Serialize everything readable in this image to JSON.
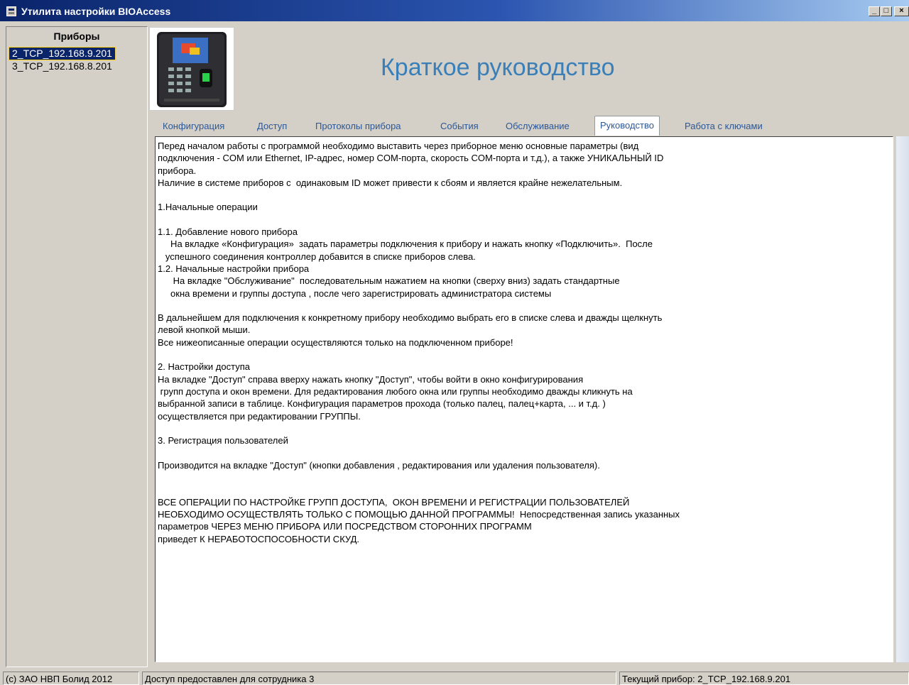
{
  "window": {
    "title": "Утилита настройки BIOAccess",
    "min": "_",
    "max": "□",
    "close": "×"
  },
  "sidebar": {
    "header": "Приборы",
    "devices": [
      {
        "label": "2_TCP_192.168.9.201",
        "selected": true
      },
      {
        "label": "3_TCP_192.168.8.201",
        "selected": false
      }
    ]
  },
  "header": {
    "title": "Краткое руководство"
  },
  "tabs": [
    {
      "label": "Конфигурация"
    },
    {
      "label": "Доступ"
    },
    {
      "label": "Протоколы прибора"
    },
    {
      "label": "События"
    },
    {
      "label": "Обслуживание"
    },
    {
      "label": "Руководство",
      "active": true
    },
    {
      "label": "Работа с ключами"
    }
  ],
  "guide": {
    "lines": [
      "Перед началом работы с программой необходимо выставить через приборное меню основные параметры (вид",
      "подключения - COM или Ethernet, IP-адрес, номер COM-порта, скорость COM-порта и т.д.), а также УНИКАЛЬНЫЙ ID",
      "прибора.",
      "Наличие в системе приборов с  одинаковым ID может привести к сбоям и является крайне нежелательным.",
      "",
      "1.Начальные операции",
      "",
      "1.1. Добавление нового прибора",
      "     На вкладке «Конфигурация»  задать параметры подключения к прибору и нажать кнопку «Подключить».  После",
      "   успешного соединения контроллер добавится в списке приборов слева.",
      "1.2. Начальные настройки прибора",
      "      На вкладке \"Обслуживание\"  последовательным нажатием на кнопки (сверху вниз) задать стандартные",
      "     окна времени и группы доступа , после чего зарегистрировать администратора системы",
      "",
      "В дальнейшем для подключения к конкретному прибору необходимо выбрать его в списке слева и дважды щелкнуть",
      "левой кнопкой мыши.",
      "Все нижеописанные операции осуществляются только на подключенном приборе!",
      "",
      "2. Настройки доступа",
      "На вкладке \"Доступ\" справа вверху нажать кнопку \"Доступ\", чтобы войти в окно конфигурирования",
      " групп доступа и окон времени. Для редактирования любого окна или группы необходимо дважды кликнуть на",
      "выбранной записи в таблице. Конфигурация параметров прохода (только палец, палец+карта, ... и т.д. )",
      "осуществляется при редактировании ГРУППЫ.",
      "",
      "3. Регистрация пользователей",
      "",
      "Производится на вкладке \"Доступ\" (кнопки добавления , редактирования или удаления пользователя).",
      "",
      "",
      "ВСЕ ОПЕРАЦИИ ПО НАСТРОЙКЕ ГРУПП ДОСТУПА,  ОКОН ВРЕМЕНИ И РЕГИСТРАЦИИ ПОЛЬЗОВАТЕЛЕЙ",
      "НЕОБХОДИМО ОСУЩЕСТВЛЯТЬ ТОЛЬКО С ПОМОЩЬЮ ДАННОЙ ПРОГРАММЫ!  Непосредственная запись указанных",
      "параметров ЧЕРЕЗ МЕНЮ ПРИБОРА ИЛИ ПОСРЕДСТВОМ СТОРОННИХ ПРОГРАММ",
      "приведет К НЕРАБОТОСПОСОБНОСТИ СКУД."
    ]
  },
  "status": {
    "copyright": "(c) ЗАО НВП Болид 2012",
    "access": "Доступ предоставлен для сотрудника 3",
    "current_device": "Текущий прибор: 2_TCP_192.168.9.201"
  }
}
